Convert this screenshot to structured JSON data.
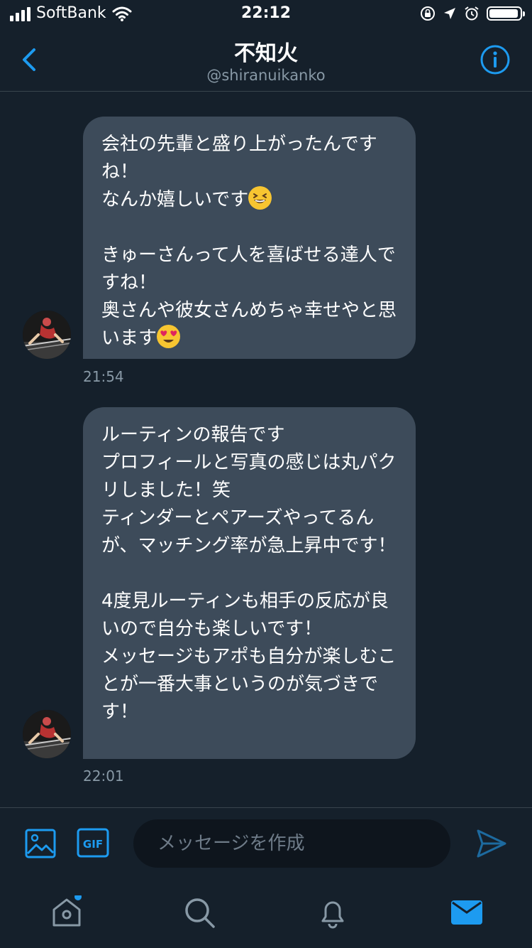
{
  "status_bar": {
    "carrier": "SoftBank",
    "time": "22:12"
  },
  "header": {
    "title": "不知火",
    "handle": "@shiranuikanko"
  },
  "messages": [
    {
      "text_before_emoji_1": "会社の先輩と盛り上がったんですね！\nなんか嬉しいです",
      "emoji_1": "grinning-squinting-face-emoji",
      "text_before_emoji_2": "\n\nきゅーさんって人を喜ばせる達人ですね！\n奥さんや彼女さんめちゃ幸せやと思います",
      "emoji_2": "heart-eyes-emoji",
      "time": "21:54"
    },
    {
      "text": "ルーティンの報告です\nプロフィールと写真の感じは丸パクリしました！笑\nティンダーとペアーズやってるんが、マッチング率が急上昇中です！\n\n4度見ルーティンも相手の反応が良いので自分も楽しいです！\nメッセージもアポも自分が楽しむことが一番大事というのが気づきです！",
      "time": "22:01"
    }
  ],
  "composer": {
    "placeholder": "メッセージを作成"
  },
  "tabs": [
    "home-icon",
    "search-icon",
    "notifications-icon",
    "messages-icon"
  ],
  "colors": {
    "background": "#15202b",
    "bubble": "#3d4b5a",
    "accent": "#1d9bf0",
    "muted": "#8899a6"
  }
}
